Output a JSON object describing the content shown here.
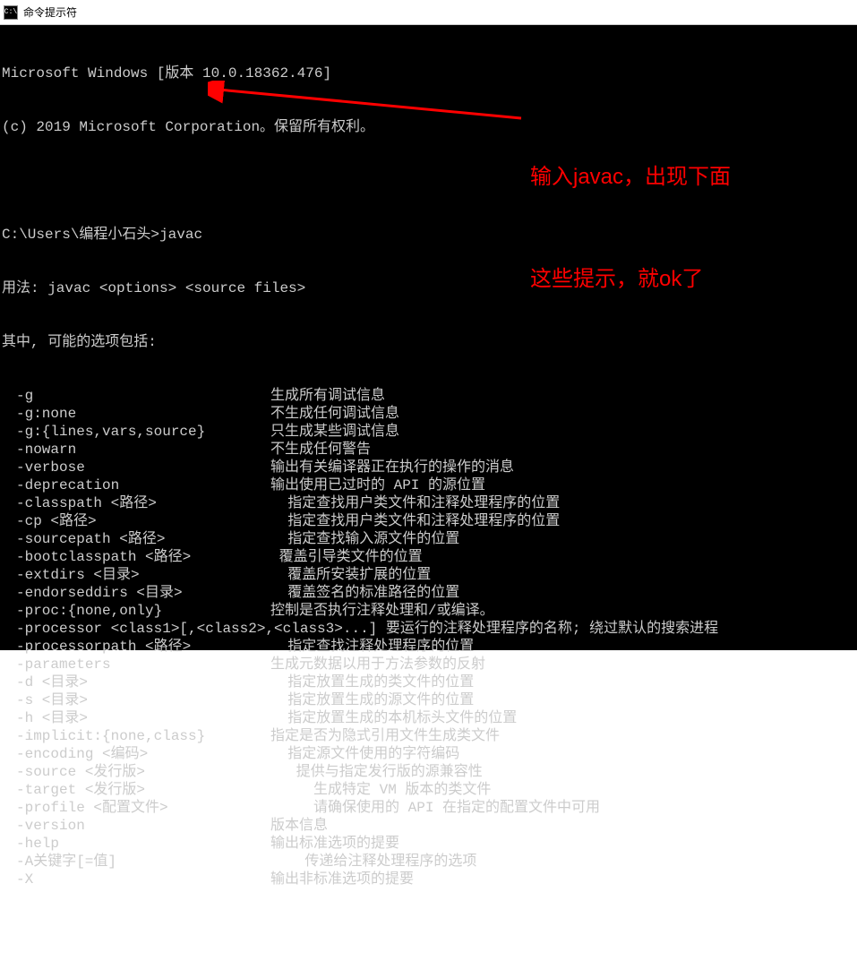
{
  "window": {
    "title": "命令提示符",
    "icon_label": "C:\\"
  },
  "header": {
    "line1": "Microsoft Windows [版本 10.0.18362.476]",
    "line2": "(c) 2019 Microsoft Corporation。保留所有权利。"
  },
  "prompt": {
    "path": "C:\\Users\\编程小石头>",
    "command": "javac"
  },
  "usage": {
    "line1": "用法: javac <options> <source files>",
    "line2": "其中, 可能的选项包括:"
  },
  "options": [
    {
      "flag": "-g",
      "desc": "生成所有调试信息"
    },
    {
      "flag": "-g:none",
      "desc": "不生成任何调试信息"
    },
    {
      "flag": "-g:{lines,vars,source}",
      "desc": "只生成某些调试信息"
    },
    {
      "flag": "-nowarn",
      "desc": "不生成任何警告"
    },
    {
      "flag": "-verbose",
      "desc": "输出有关编译器正在执行的操作的消息"
    },
    {
      "flag": "-deprecation",
      "desc": "输出使用已过时的 API 的源位置"
    },
    {
      "flag": "-classpath <路径>",
      "desc": "  指定查找用户类文件和注释处理程序的位置"
    },
    {
      "flag": "-cp <路径>",
      "desc": "  指定查找用户类文件和注释处理程序的位置"
    },
    {
      "flag": "-sourcepath <路径>",
      "desc": "  指定查找输入源文件的位置"
    },
    {
      "flag": "-bootclasspath <路径>",
      "desc": " 覆盖引导类文件的位置"
    },
    {
      "flag": "-extdirs <目录>",
      "desc": "  覆盖所安装扩展的位置"
    },
    {
      "flag": "-endorseddirs <目录>",
      "desc": "  覆盖签名的标准路径的位置"
    },
    {
      "flag": "-proc:{none,only}",
      "desc": "控制是否执行注释处理和/或编译。"
    },
    {
      "flag": "-processor <class1>[,<class2>,<class3>...]",
      "desc": "要运行的注释处理程序的名称; 绕过默认的搜索进程",
      "nowrap": true
    },
    {
      "flag": "-processorpath <路径>",
      "desc": "  指定查找注释处理程序的位置"
    },
    {
      "flag": "-parameters",
      "desc": "生成元数据以用于方法参数的反射"
    },
    {
      "flag": "-d <目录>",
      "desc": "  指定放置生成的类文件的位置"
    },
    {
      "flag": "-s <目录>",
      "desc": "  指定放置生成的源文件的位置"
    },
    {
      "flag": "-h <目录>",
      "desc": "  指定放置生成的本机标头文件的位置"
    },
    {
      "flag": "-implicit:{none,class}",
      "desc": "指定是否为隐式引用文件生成类文件"
    },
    {
      "flag": "-encoding <编码>",
      "desc": "  指定源文件使用的字符编码"
    },
    {
      "flag": "-source <发行版>",
      "desc": "   提供与指定发行版的源兼容性"
    },
    {
      "flag": "-target <发行版>",
      "desc": "     生成特定 VM 版本的类文件"
    },
    {
      "flag": "-profile <配置文件>",
      "desc": "     请确保使用的 API 在指定的配置文件中可用"
    },
    {
      "flag": "-version",
      "desc": "版本信息"
    },
    {
      "flag": "-help",
      "desc": "输出标准选项的提要"
    },
    {
      "flag": "-A关键字[=值]",
      "desc": "    传递给注释处理程序的选项"
    },
    {
      "flag": "-X",
      "desc": "输出非标准选项的提要"
    }
  ],
  "annotation": {
    "line1": "输入javac，出现下面",
    "line2": "这些提示，就ok了"
  }
}
